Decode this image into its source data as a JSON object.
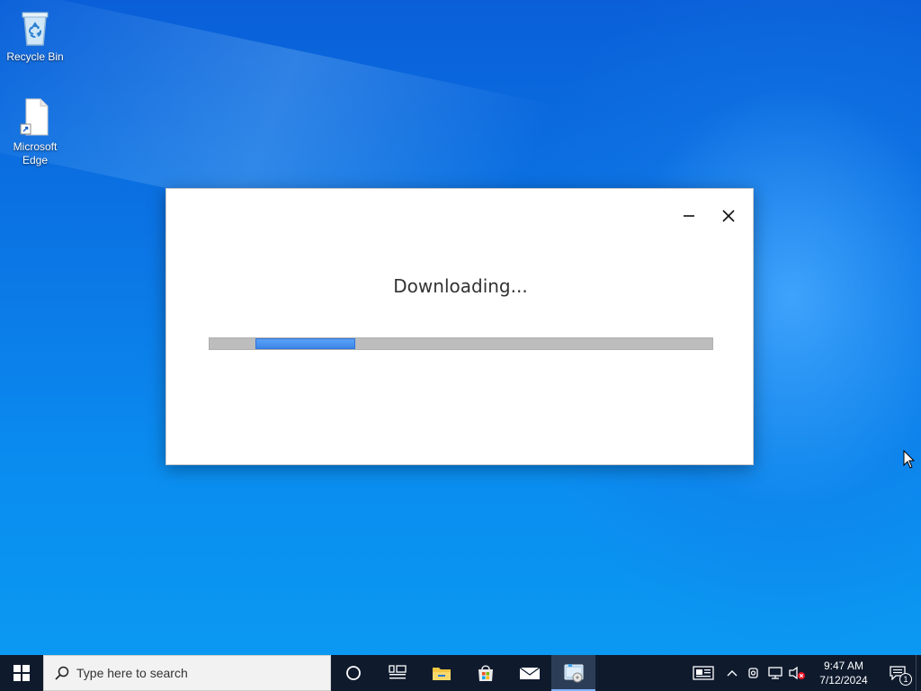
{
  "desktop": {
    "icons": [
      {
        "label": "Recycle Bin",
        "icon": "recycle-bin-icon"
      },
      {
        "label": "Microsoft Edge",
        "icon": "shortcut-file-icon"
      }
    ]
  },
  "dialog": {
    "status_text": "Downloading...",
    "progress_indeterminate": true,
    "colors": {
      "progress_fill": "#3d86ea",
      "progress_track": "#bdbdbd"
    }
  },
  "taskbar": {
    "search_placeholder": "Type here to search",
    "apps": [
      "cortana-icon",
      "task-view-icon",
      "file-explorer-icon",
      "microsoft-store-icon",
      "mail-icon",
      "installer-app-icon"
    ],
    "clock": {
      "time": "9:47 AM",
      "date": "7/12/2024"
    },
    "notification_count": "1"
  }
}
